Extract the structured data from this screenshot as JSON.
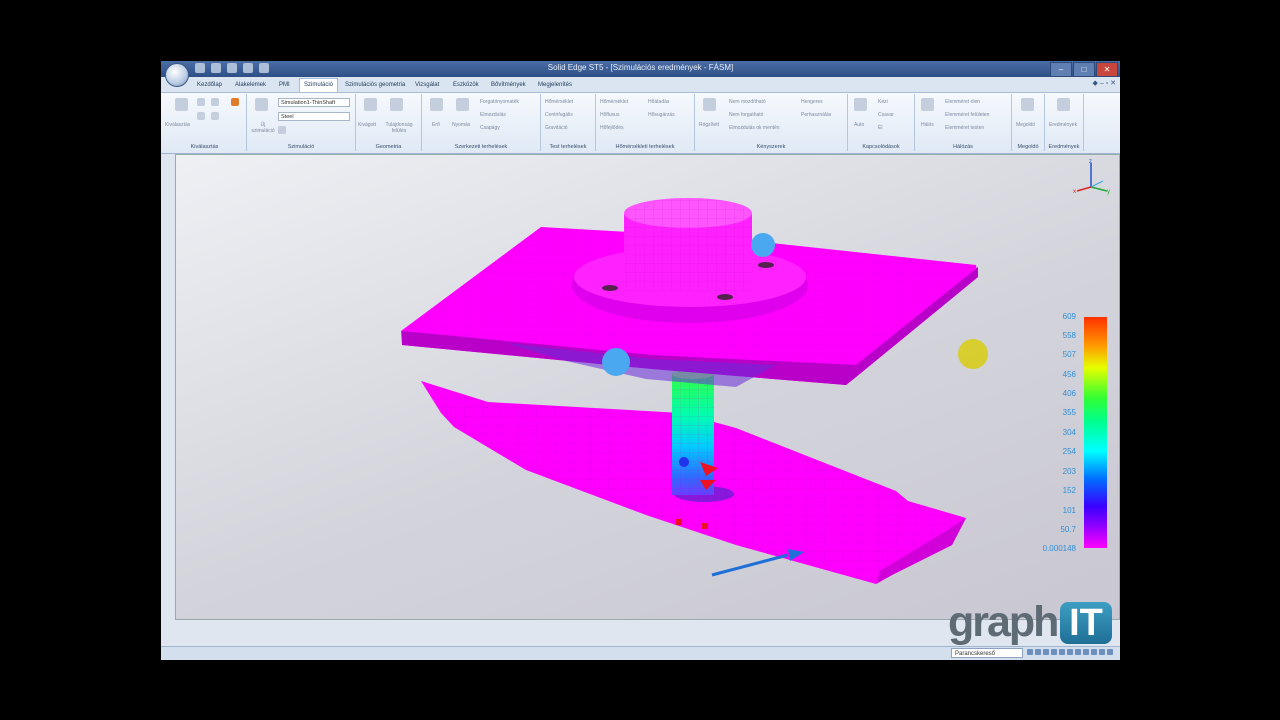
{
  "window": {
    "title": "Solid Edge ST5 - [Szimulációs eredmények - FÁSM]",
    "controls": [
      "–",
      "□",
      "✕"
    ]
  },
  "ribbon_tabs": [
    {
      "label": "Kezdőlap",
      "active": false
    },
    {
      "label": "Alakelemek",
      "active": false
    },
    {
      "label": "PMI",
      "active": false
    },
    {
      "label": "Szimuláció",
      "active": true
    },
    {
      "label": "Szimulációs geometria",
      "active": false
    },
    {
      "label": "Vizsgálat",
      "active": false
    },
    {
      "label": "Eszközök",
      "active": false
    },
    {
      "label": "Bővítmények",
      "active": false
    },
    {
      "label": "Megjelenítés",
      "active": false
    }
  ],
  "ribbon": {
    "groups": [
      {
        "label": "Kiválasztás",
        "items": [
          "Kiválasztás"
        ]
      },
      {
        "label": "Szimuláció",
        "items": [
          "Új szimuláció"
        ],
        "study": "Simulation1-ThinShaft",
        "material": "Steel"
      },
      {
        "label": "Geometria",
        "items": [
          "Kivágott",
          "Tulajdonság felülés"
        ]
      },
      {
        "label": "Szerkezeti terhelések",
        "items": [
          "Erő",
          "Nyomás",
          "Forgatónyomaték",
          "Elmozdulás",
          "Csapágy"
        ]
      },
      {
        "label": "Test terhelések",
        "items": [
          "Hőmérséklet",
          "Centrifugális",
          "Gravitáció"
        ]
      },
      {
        "label": "Hőmérsékleti terhelések",
        "items": [
          "Hőmérséklet",
          "Hőfluxus",
          "Hőfejlődés",
          "Hőátadás",
          "Hősugárzás"
        ]
      },
      {
        "label": "Kényszerek",
        "items": [
          "Rögzített",
          "Nem mozdítható",
          "Nem forgatható",
          "Elmozdulás ok mentén",
          "Hengeres",
          "Perhasználás"
        ]
      },
      {
        "label": "Kapcsolódások",
        "items": [
          "Auto",
          "Kézi",
          "Csavar",
          "Él"
        ]
      },
      {
        "label": "Hálózás",
        "items": [
          "Hálós",
          "Elemméret élen",
          "Elemméret felületen",
          "Elemméret testen"
        ]
      },
      {
        "label": "Megoldó",
        "items": [
          "Megoldó"
        ]
      },
      {
        "label": "Eredmények",
        "items": [
          "Eredmények"
        ]
      }
    ]
  },
  "legend": {
    "labels": [
      "609",
      "558",
      "507",
      "456",
      "406",
      "355",
      "304",
      "254",
      "203",
      "152",
      "101",
      "50.7",
      "0.000148"
    ]
  },
  "triad": {
    "x": "x",
    "y": "y",
    "z": "z"
  },
  "statusbar": {
    "command_finder": "Parancskereső"
  },
  "logo": {
    "text": "graph",
    "badge": "IT"
  },
  "colors": {
    "accent": "#2e4f86",
    "mesh_body": "#ff00ff",
    "legend_text": "#2d8fd6"
  }
}
